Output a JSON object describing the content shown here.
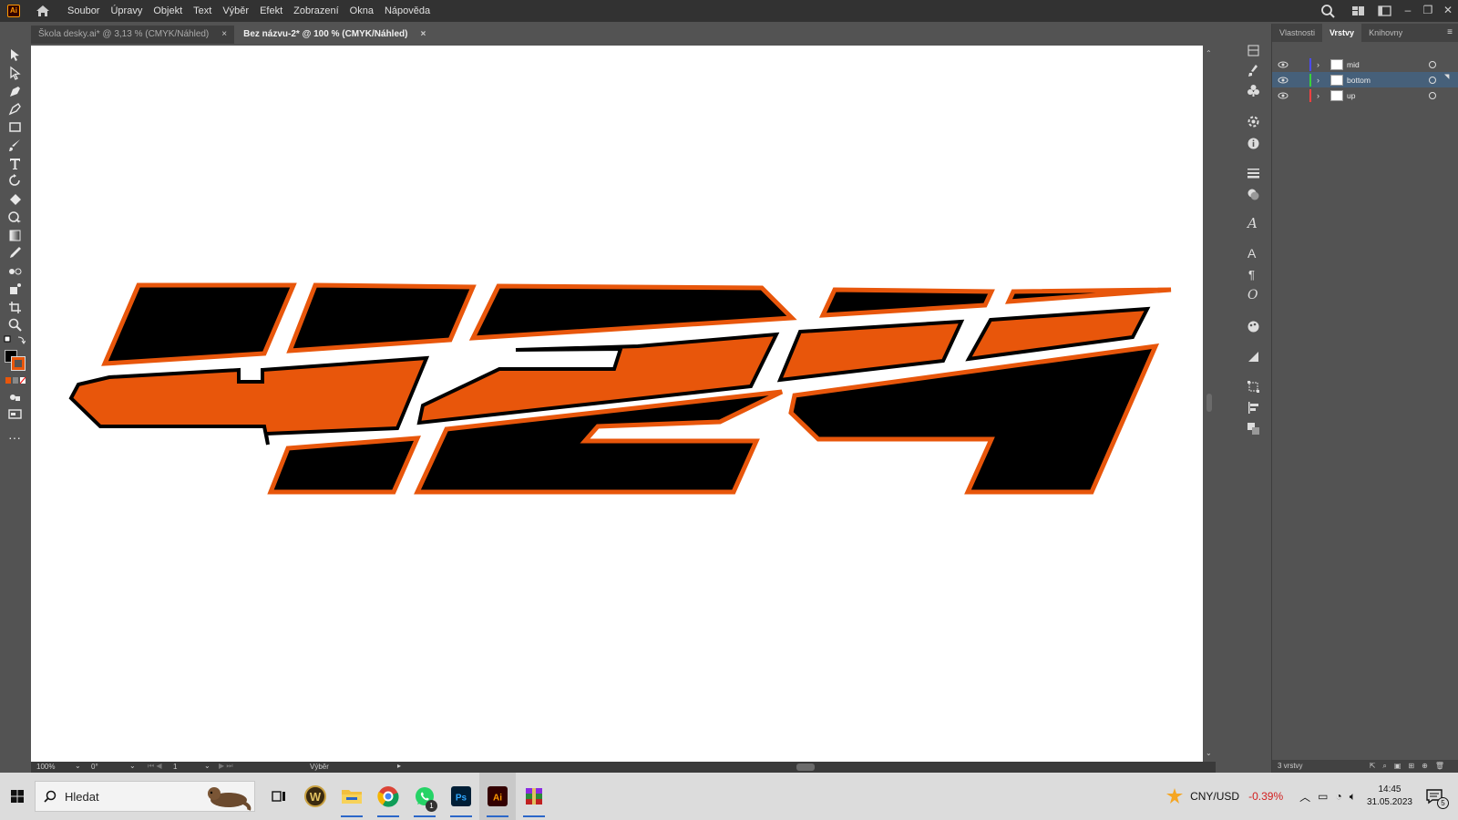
{
  "app": {
    "logo_text": "Ai",
    "menu": [
      "Soubor",
      "Úpravy",
      "Objekt",
      "Text",
      "Výběr",
      "Efekt",
      "Zobrazení",
      "Okna",
      "Nápověda"
    ]
  },
  "tabs": [
    {
      "title": "Škola desky.ai* @ 3,13 % (CMYK/Náhled)",
      "close": "×",
      "active": false
    },
    {
      "title": "Bez názvu-2* @ 100 % (CMYK/Náhled)",
      "close": "×",
      "active": true
    }
  ],
  "panel": {
    "tabs": [
      "Vlastnosti",
      "Vrstvy",
      "Knihovny"
    ],
    "active_tab": "Vrstvy",
    "layers": [
      {
        "name": "mid",
        "color": "#4a4aff",
        "selected": false
      },
      {
        "name": "bottom",
        "color": "#3ad13a",
        "selected": true
      },
      {
        "name": "up",
        "color": "#ff4040",
        "selected": false
      }
    ],
    "footer": "3 vrstvy"
  },
  "status": {
    "zoom": "100%",
    "rotation": "0°",
    "artboard": "1",
    "tool": "Výběr"
  },
  "taskbar": {
    "search_placeholder": "Hledat",
    "currency_pair": "CNY/USD",
    "currency_change": "-0.39%",
    "time": "14:45",
    "date": "31.05.2023",
    "notifications": "5",
    "whatsapp_badge": "1"
  },
  "colors": {
    "accent_orange": "#e8560b",
    "black": "#000000",
    "selected_row": "#46607a"
  }
}
